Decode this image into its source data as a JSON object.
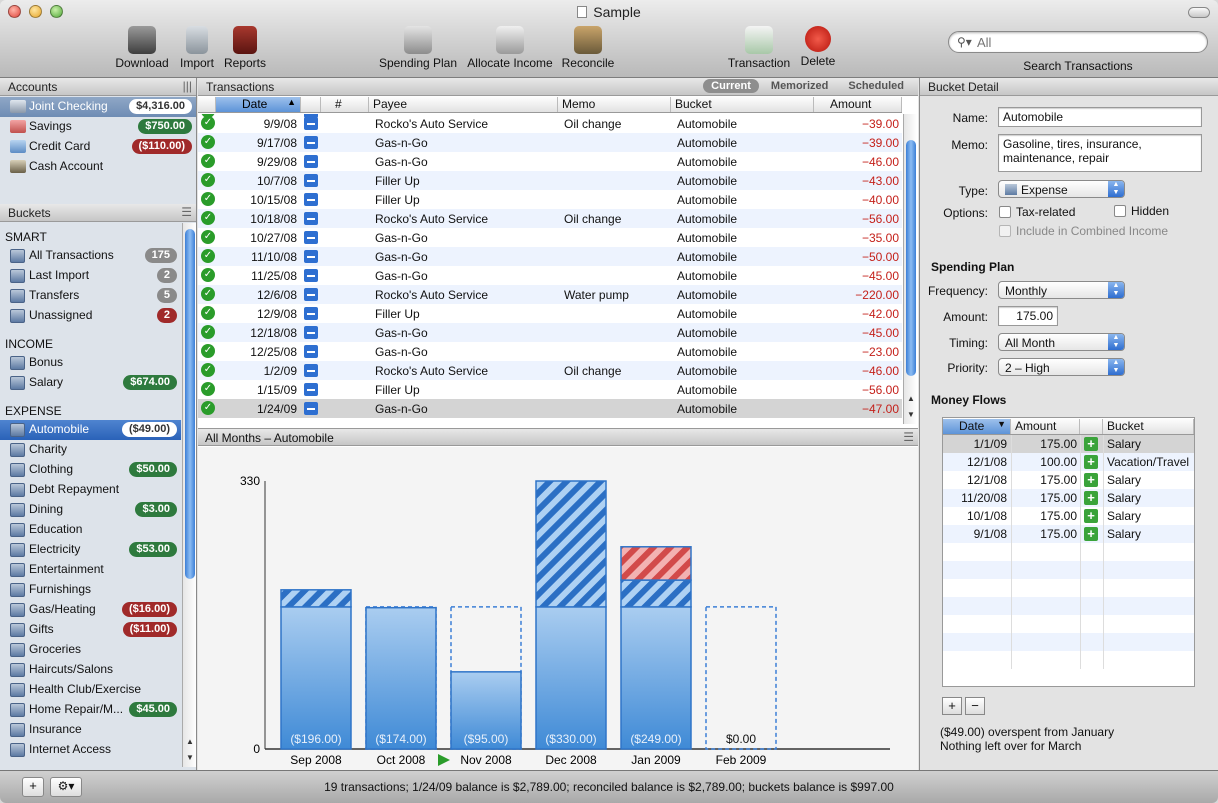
{
  "window": {
    "title": "Sample"
  },
  "toolbar": {
    "download": "Download",
    "import": "Import",
    "reports": "Reports",
    "spending_plan": "Spending Plan",
    "allocate_income": "Allocate Income",
    "reconcile": "Reconcile",
    "transaction": "Transaction",
    "delete": "Delete",
    "search_placeholder": "All",
    "search_label": "Search Transactions"
  },
  "accounts": {
    "header": "Accounts",
    "items": [
      {
        "name": "Joint Checking",
        "balance": "$4,316.00",
        "style": "white"
      },
      {
        "name": "Savings",
        "balance": "$750.00",
        "style": "green"
      },
      {
        "name": "Credit Card",
        "balance": "($110.00)",
        "style": "red"
      },
      {
        "name": "Cash Account",
        "balance": "",
        "style": ""
      }
    ]
  },
  "buckets": {
    "header": "Buckets",
    "groups": [
      {
        "name": "SMART",
        "items": [
          {
            "name": "All Transactions",
            "badge": "175",
            "style": "gray"
          },
          {
            "name": "Last Import",
            "badge": "2",
            "style": "gray"
          },
          {
            "name": "Transfers",
            "badge": "5",
            "style": "gray"
          },
          {
            "name": "Unassigned",
            "badge": "2",
            "style": "red"
          }
        ]
      },
      {
        "name": "INCOME",
        "items": [
          {
            "name": "Bonus",
            "badge": "",
            "style": ""
          },
          {
            "name": "Salary",
            "badge": "$674.00",
            "style": "green"
          }
        ]
      },
      {
        "name": "EXPENSE",
        "items": [
          {
            "name": "Automobile",
            "badge": "($49.00)",
            "style": "white"
          },
          {
            "name": "Charity",
            "badge": "",
            "style": ""
          },
          {
            "name": "Clothing",
            "badge": "$50.00",
            "style": "green"
          },
          {
            "name": "Debt Repayment",
            "badge": "",
            "style": ""
          },
          {
            "name": "Dining",
            "badge": "$3.00",
            "style": "green"
          },
          {
            "name": "Education",
            "badge": "",
            "style": ""
          },
          {
            "name": "Electricity",
            "badge": "$53.00",
            "style": "green"
          },
          {
            "name": "Entertainment",
            "badge": "",
            "style": ""
          },
          {
            "name": "Furnishings",
            "badge": "",
            "style": ""
          },
          {
            "name": "Gas/Heating",
            "badge": "($16.00)",
            "style": "red"
          },
          {
            "name": "Gifts",
            "badge": "($11.00)",
            "style": "red"
          },
          {
            "name": "Groceries",
            "badge": "",
            "style": ""
          },
          {
            "name": "Haircuts/Salons",
            "badge": "",
            "style": ""
          },
          {
            "name": "Health Club/Exercise",
            "badge": "",
            "style": ""
          },
          {
            "name": "Home Repair/M...",
            "badge": "$45.00",
            "style": "green"
          },
          {
            "name": "Insurance",
            "badge": "",
            "style": ""
          },
          {
            "name": "Internet Access",
            "badge": "",
            "style": ""
          }
        ]
      }
    ]
  },
  "transactions": {
    "header": "Transactions",
    "tabs": [
      "Current",
      "Memorized",
      "Scheduled"
    ],
    "columns": [
      "Date",
      "#",
      "Payee",
      "Memo",
      "Bucket",
      "Amount"
    ],
    "rows": [
      {
        "date": "9/9/08",
        "payee": "Rocko's Auto Service",
        "memo": "Oil change",
        "bucket": "Automobile",
        "amount": "−39.00"
      },
      {
        "date": "9/17/08",
        "payee": "Gas-n-Go",
        "memo": "",
        "bucket": "Automobile",
        "amount": "−39.00"
      },
      {
        "date": "9/29/08",
        "payee": "Gas-n-Go",
        "memo": "",
        "bucket": "Automobile",
        "amount": "−46.00"
      },
      {
        "date": "10/7/08",
        "payee": "Filler Up",
        "memo": "",
        "bucket": "Automobile",
        "amount": "−43.00"
      },
      {
        "date": "10/15/08",
        "payee": "Filler Up",
        "memo": "",
        "bucket": "Automobile",
        "amount": "−40.00"
      },
      {
        "date": "10/18/08",
        "payee": "Rocko's Auto Service",
        "memo": "Oil change",
        "bucket": "Automobile",
        "amount": "−56.00"
      },
      {
        "date": "10/27/08",
        "payee": "Gas-n-Go",
        "memo": "",
        "bucket": "Automobile",
        "amount": "−35.00"
      },
      {
        "date": "11/10/08",
        "payee": "Gas-n-Go",
        "memo": "",
        "bucket": "Automobile",
        "amount": "−50.00"
      },
      {
        "date": "11/25/08",
        "payee": "Gas-n-Go",
        "memo": "",
        "bucket": "Automobile",
        "amount": "−45.00"
      },
      {
        "date": "12/6/08",
        "payee": "Rocko's Auto Service",
        "memo": "Water pump",
        "bucket": "Automobile",
        "amount": "−220.00"
      },
      {
        "date": "12/9/08",
        "payee": "Filler Up",
        "memo": "",
        "bucket": "Automobile",
        "amount": "−42.00"
      },
      {
        "date": "12/18/08",
        "payee": "Gas-n-Go",
        "memo": "",
        "bucket": "Automobile",
        "amount": "−45.00"
      },
      {
        "date": "12/25/08",
        "payee": "Gas-n-Go",
        "memo": "",
        "bucket": "Automobile",
        "amount": "−23.00"
      },
      {
        "date": "1/2/09",
        "payee": "Rocko's Auto Service",
        "memo": "Oil change",
        "bucket": "Automobile",
        "amount": "−46.00"
      },
      {
        "date": "1/15/09",
        "payee": "Filler Up",
        "memo": "",
        "bucket": "Automobile",
        "amount": "−56.00"
      },
      {
        "date": "1/24/09",
        "payee": "Gas-n-Go",
        "memo": "",
        "bucket": "Automobile",
        "amount": "−47.00"
      }
    ]
  },
  "chart_header": "All Months – Automobile",
  "chart_data": {
    "type": "bar",
    "categories": [
      "Sep 2008",
      "Oct 2008",
      "Nov 2008",
      "Dec 2008",
      "Jan 2009",
      "Feb 2009"
    ],
    "values": [
      196,
      174,
      95,
      330,
      249,
      0
    ],
    "plan": [
      175,
      175,
      175,
      175,
      175,
      175
    ],
    "labels": [
      "($196.00)",
      "($174.00)",
      "($95.00)",
      "($330.00)",
      "($249.00)",
      "$0.00"
    ],
    "ylim": [
      0,
      330
    ],
    "yticks": [
      "0",
      "330"
    ],
    "current_index": 2
  },
  "bucket_detail": {
    "header": "Bucket Detail",
    "name_label": "Name:",
    "name": "Automobile",
    "memo_label": "Memo:",
    "memo": "Gasoline, tires, insurance, maintenance, repair",
    "type_label": "Type:",
    "type": "Expense",
    "options_label": "Options:",
    "tax_related": "Tax-related",
    "hidden": "Hidden",
    "include_combined": "Include in Combined Income",
    "spending_plan_title": "Spending Plan",
    "frequency_label": "Frequency:",
    "frequency": "Monthly",
    "amount_label": "Amount:",
    "amount": "175.00",
    "timing_label": "Timing:",
    "timing": "All Month",
    "priority_label": "Priority:",
    "priority": "2 – High",
    "money_flows_title": "Money Flows",
    "mf_columns": [
      "Date",
      "Amount",
      "",
      "Bucket"
    ],
    "mf_rows": [
      {
        "date": "1/1/09",
        "amount": "175.00",
        "bucket": "Salary"
      },
      {
        "date": "12/1/08",
        "amount": "100.00",
        "bucket": "Vacation/Travel"
      },
      {
        "date": "12/1/08",
        "amount": "175.00",
        "bucket": "Salary"
      },
      {
        "date": "11/20/08",
        "amount": "175.00",
        "bucket": "Salary"
      },
      {
        "date": "10/1/08",
        "amount": "175.00",
        "bucket": "Salary"
      },
      {
        "date": "9/1/08",
        "amount": "175.00",
        "bucket": "Salary"
      }
    ],
    "note_1": "($49.00) overspent from January",
    "note_2": "Nothing left over for March"
  },
  "status": {
    "message": "19 transactions; 1/24/09 balance is $2,789.00; reconciled balance is $2,789.00; buckets balance is $997.00"
  },
  "colors": {
    "accent": "#3c7fd6",
    "negative": "#c4201a",
    "positive_badge": "#2e7a3e",
    "negative_badge": "#a02a2a"
  }
}
